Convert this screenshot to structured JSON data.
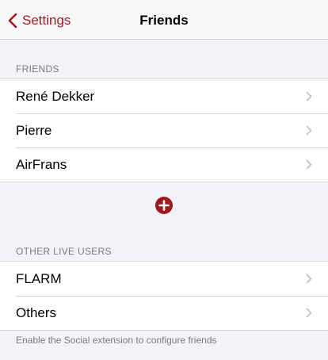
{
  "navbar": {
    "back_label": "Settings",
    "title": "Friends"
  },
  "friends_section": {
    "header": "FRIENDS",
    "items": [
      {
        "label": "René Dekker"
      },
      {
        "label": "Pierre"
      },
      {
        "label": "AirFrans"
      }
    ]
  },
  "add_button": {
    "icon": "plus-circle-icon"
  },
  "other_section": {
    "header": "OTHER LIVE USERS",
    "items": [
      {
        "label": "FLARM"
      },
      {
        "label": "Others"
      }
    ],
    "footer": "Enable the Social extension to configure friends"
  },
  "colors": {
    "accent": "#9b1b1f",
    "background": "#f2f2f7",
    "secondary_text": "#7b7b80"
  }
}
